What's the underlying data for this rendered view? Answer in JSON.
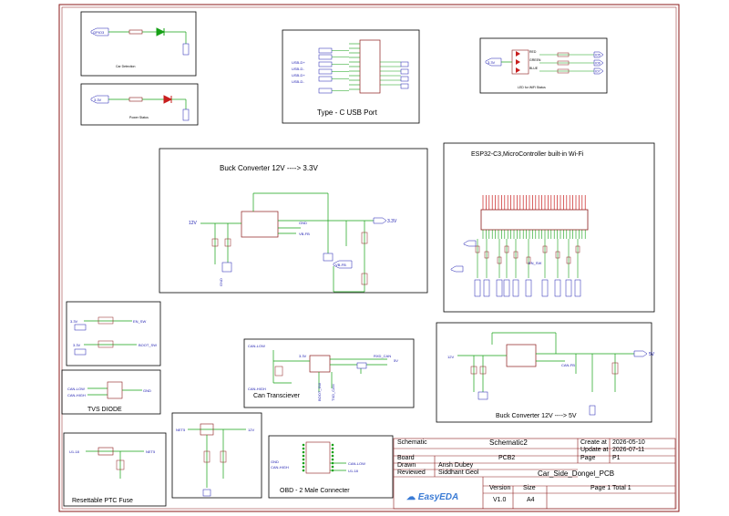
{
  "colors": {
    "border": "#8b1a1a",
    "wire": "#15a015",
    "net": "#1b1bb0",
    "part": "#8b1a1a",
    "text": "#000000",
    "easyeda": "#3a7bd5"
  },
  "sections": {
    "led_car": "Car Detection",
    "led_power": "Power Status",
    "usb": "Type - C USB Port",
    "rgb": "LED for WiFi Status",
    "buck33": "Buck Converter 12V ----> 3.3V",
    "esp": "ESP32-C3,MicroController built-in Wi-Fi",
    "buttons": "",
    "tvs": "TVS DIODE",
    "can": "Can Transciever",
    "buck5": "Buck Converter 12V ----> 5V",
    "ptc": "Resettable PTC Fuse",
    "obd": "OBD - 2 Male Connecter"
  },
  "nets": {
    "gpio3": "GPIO3",
    "v33": "3.3V",
    "v12": "12V",
    "v5": "5V",
    "gnd": "GND",
    "usb_dp": "USB-D+",
    "usb_dm": "USB-D-",
    "red": "RED",
    "green": "GREEN",
    "blue": "BLUE",
    "io5": "IO5",
    "io6": "IO6",
    "io7": "IO7",
    "vbfb": "VB-FB",
    "en_sw": "EN_SW",
    "boot_sw": "BOOT_SW",
    "can_low": "CAN-LOW",
    "can_high": "CAN-HIGH",
    "rxd_can": "RXD_CAN",
    "txd_can": "TXD_CAN",
    "net5": "NET5",
    "u118": "U1-18",
    "boot_sw2": "BOOT_SW",
    "can_fb": "CAN-FB"
  },
  "title_block": {
    "schematic_label": "Schematic",
    "schematic_value": "Schematic2",
    "create_at_label": "Create at",
    "create_at_value": "2026-05-10",
    "update_at_label": "Update at",
    "update_at_value": "2026-07-11",
    "board_label": "Board",
    "board_value": "PCB2",
    "page_label": "Page",
    "page_value": "P1",
    "drawn_label": "Drawn",
    "drawn_value": "Ansh Dubey",
    "reviewed_label": "Reviewed",
    "reviewed_value": "Siddhant Geol",
    "project_name": "Car_Side_Dongel_PCB",
    "logo_text": "EasyEDA",
    "version_label": "Version",
    "version_value": "V1.0",
    "size_label": "Size",
    "size_value": "A4",
    "page_total": "Page 1 Total 1"
  }
}
